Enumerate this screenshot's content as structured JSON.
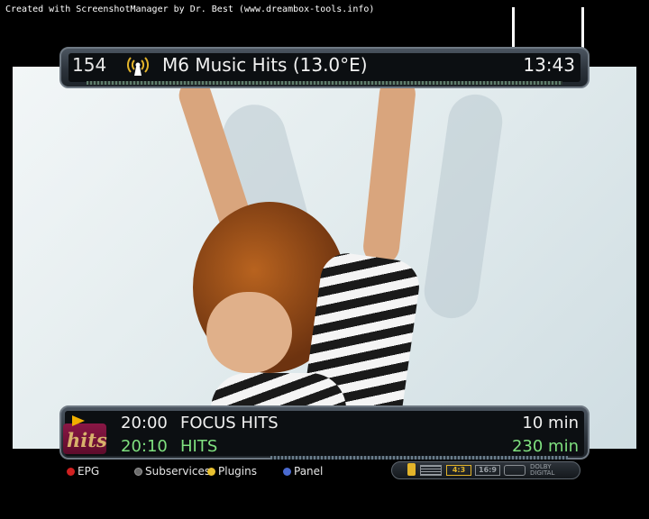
{
  "watermark": "Created with ScreenshotManager by Dr. Best (www.dreambox-tools.info)",
  "channel": {
    "number": "154",
    "name": "M6 Music Hits (13.0°E)",
    "clock": "13:43",
    "icon": "antenna-icon"
  },
  "epg": {
    "logo_text": "hits",
    "now": {
      "time": "20:00",
      "title": "FOCUS HITS",
      "duration": "10 min"
    },
    "next": {
      "time": "20:10",
      "title": "HITS",
      "duration": "230 min"
    }
  },
  "legend": [
    {
      "label": "EPG",
      "color": "#d02020"
    },
    {
      "label": "Subservices",
      "color": "#6a6a6a"
    },
    {
      "label": "Plugins",
      "color": "#e8c030"
    },
    {
      "label": "Panel",
      "color": "#4a6ad0"
    }
  ],
  "status": {
    "aspect_43": "4:3",
    "aspect_169": "16:9",
    "dolby_top": "DOLBY",
    "dolby_bottom": "DIGITAL",
    "accent": "#e3b42a"
  }
}
